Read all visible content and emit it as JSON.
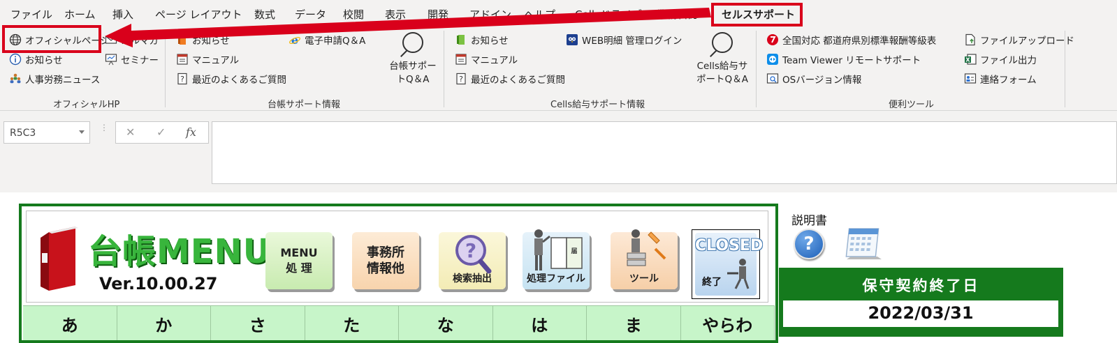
{
  "tabs": [
    "ファイル",
    "ホーム",
    "挿入",
    "ページ レイアウト",
    "数式",
    "データ",
    "校閲",
    "表示",
    "開発",
    "アドイン",
    "ヘルプ",
    "Cellsドライブ",
    "業務日誌",
    "セルスサポート"
  ],
  "active_tab": "セルスサポート",
  "ribbon": {
    "official": {
      "items": [
        "オフィシャルページ",
        "お知らせ",
        "人事労務ニュース"
      ],
      "mail_fragment": "メルマガ",
      "seminar": "セミナー",
      "label": "オフィシャルHP"
    },
    "daicho": {
      "items": [
        "お知らせ",
        "マニュアル",
        "最近のよくあるご質問"
      ],
      "denshi": "電子申請Q＆A",
      "big_line1": "台帳サポー",
      "big_line2": "トQ＆A",
      "label": "台帳サポート情報"
    },
    "cells": {
      "items": [
        "お知らせ",
        "マニュアル",
        "最近のよくあるご質問"
      ],
      "web": "WEB明細 管理ログイン",
      "big_line1": "Cells給与サ",
      "big_line2": "ポートQ＆A",
      "label": "Cells給与サポート情報"
    },
    "tools": {
      "left": [
        "全国対応 都道府県別標準報酬等級表",
        "Team Viewer リモートサポート",
        "OSバージョン情報"
      ],
      "right": [
        "ファイルアップロード",
        "ファイル出力",
        "連絡フォーム"
      ],
      "label": "便利ツール"
    }
  },
  "formula_bar": {
    "name_box": "R5C3",
    "cancel": "✕",
    "enter": "✓",
    "fx": "fx",
    "content": ""
  },
  "sheet": {
    "title": "台帳MENU",
    "version": "Ver.10.00.27",
    "buttons": {
      "menu_line1": "MENU",
      "menu_line2": "処 理",
      "office_line1": "事務所",
      "office_line2": "情報他",
      "search": "検索抽出",
      "files": "処理ファイル",
      "tools": "ツール",
      "closed_title": "CLOSED",
      "closed_label": "終了"
    },
    "kana_tabs": [
      "あ",
      "か",
      "さ",
      "た",
      "な",
      "は",
      "ま",
      "やらわ"
    ],
    "manual": "説明書",
    "maintenance_title": "保守契約終了日",
    "maintenance_date": "2022/03/31"
  },
  "colors": {
    "highlight": "#d9001b",
    "sheet_green": "#157a1d",
    "kana_bg": "#c7f5c9"
  }
}
